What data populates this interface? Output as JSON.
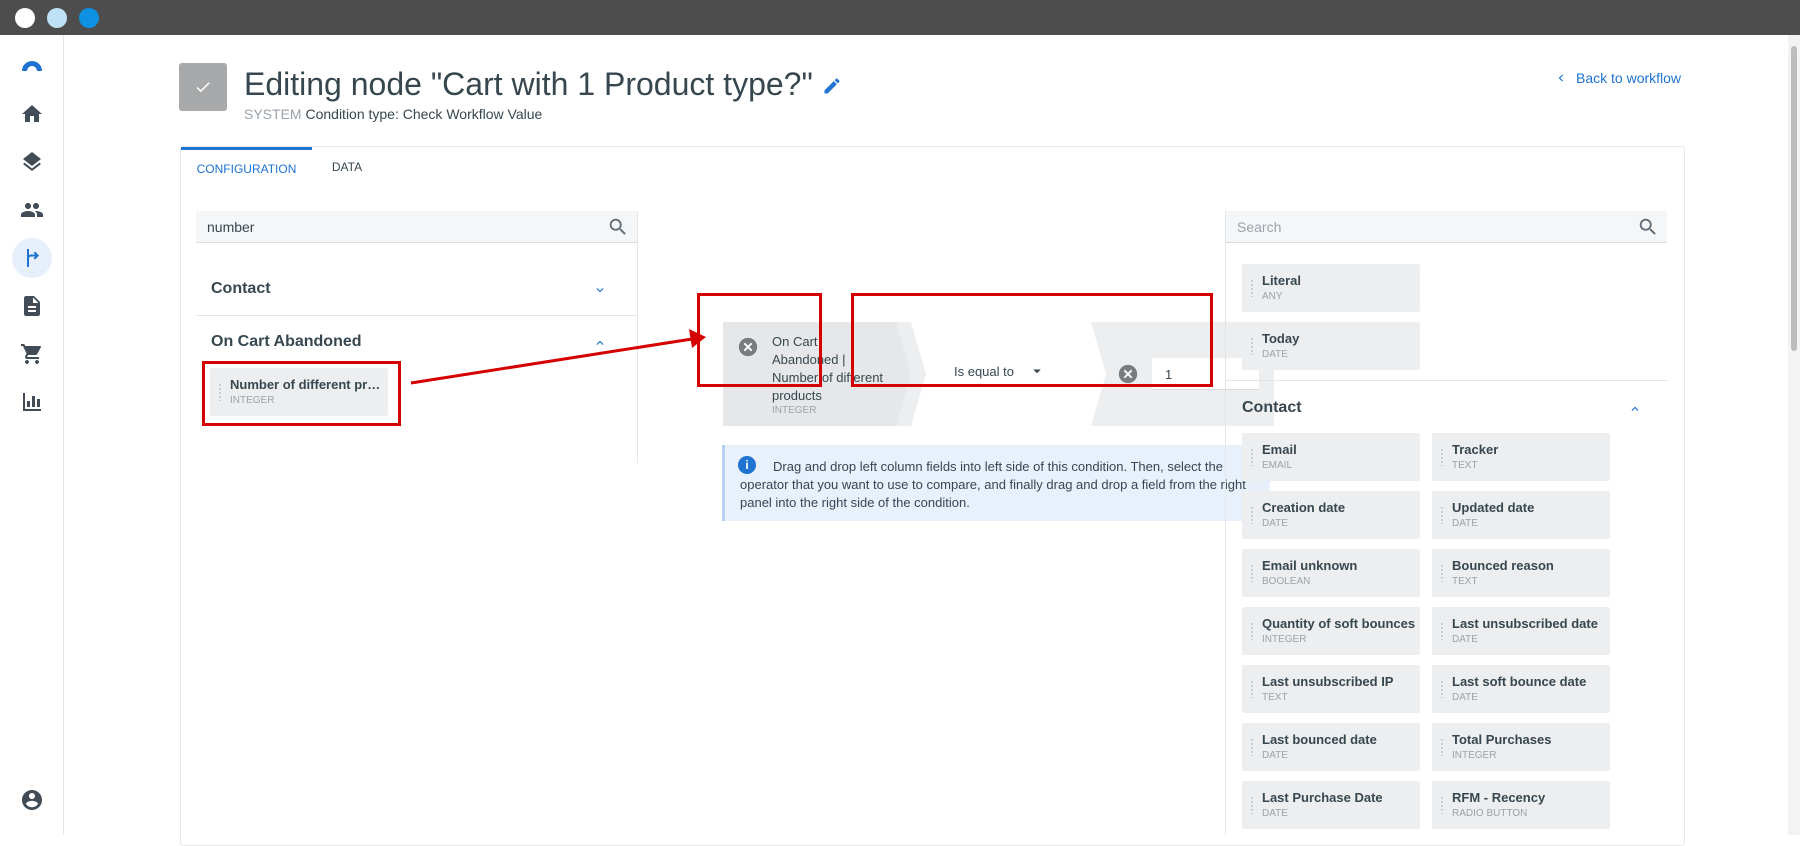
{
  "window": {
    "dots": [
      "#ffffff",
      "#bfe1f6",
      "#0e90e3"
    ]
  },
  "sidebar": {
    "items": [
      {
        "icon": "logo-icon"
      },
      {
        "icon": "home-icon"
      },
      {
        "icon": "layers-icon"
      },
      {
        "icon": "contacts-icon"
      },
      {
        "icon": "workflow-icon",
        "active": true
      },
      {
        "icon": "document-icon"
      },
      {
        "icon": "cart-icon"
      },
      {
        "icon": "reports-icon"
      },
      {
        "icon": "account-icon"
      }
    ]
  },
  "header": {
    "title": "Editing node \"Cart with 1 Product type?\"",
    "system_label": "SYSTEM",
    "condition_type": "Condition type: Check Workflow Value",
    "back_label": "Back to workflow"
  },
  "tabs": [
    {
      "label": "CONFIGURATION",
      "active": true
    },
    {
      "label": "DATA",
      "active": false
    }
  ],
  "left_panel": {
    "search_value": "number",
    "groups": [
      {
        "name": "Contact",
        "expanded": false
      },
      {
        "name": "On Cart Abandoned",
        "expanded": true
      }
    ],
    "fields": [
      {
        "name": "Number of different pr…",
        "type": "INTEGER"
      }
    ]
  },
  "condition": {
    "left_text": "On Cart Abandoned | Number of different products",
    "left_type": "INTEGER",
    "operator": "Is equal to",
    "right_value": "1"
  },
  "info": {
    "text": "Drag and drop left column fields into left side of this condition. Then, select the operator that you want to use to compare, and finally drag and drop a field from the right panel into the right side of the condition."
  },
  "right_panel": {
    "search_placeholder": "Search",
    "top_fields": [
      {
        "name": "Literal",
        "type": "ANY"
      },
      {
        "name": "Today",
        "type": "DATE"
      }
    ],
    "group": {
      "name": "Contact",
      "expanded": true
    },
    "contact_fields": [
      {
        "name": "Email",
        "type": "EMAIL"
      },
      {
        "name": "Tracker",
        "type": "TEXT"
      },
      {
        "name": "Creation date",
        "type": "DATE"
      },
      {
        "name": "Updated date",
        "type": "DATE"
      },
      {
        "name": "Email unknown",
        "type": "BOOLEAN"
      },
      {
        "name": "Bounced reason",
        "type": "TEXT"
      },
      {
        "name": "Quantity of soft bounces",
        "type": "INTEGER"
      },
      {
        "name": "Last unsubscribed date",
        "type": "DATE"
      },
      {
        "name": "Last unsubscribed IP",
        "type": "TEXT"
      },
      {
        "name": "Last soft bounce date",
        "type": "DATE"
      },
      {
        "name": "Last bounced date",
        "type": "DATE"
      },
      {
        "name": "Total Purchases",
        "type": "INTEGER"
      },
      {
        "name": "Last Purchase Date",
        "type": "DATE"
      },
      {
        "name": "RFM - Recency",
        "type": "RADIO BUTTON"
      }
    ]
  },
  "colors": {
    "accent": "#1f73d1",
    "highlight": "#d50000",
    "chip_bg": "#eceeef"
  }
}
